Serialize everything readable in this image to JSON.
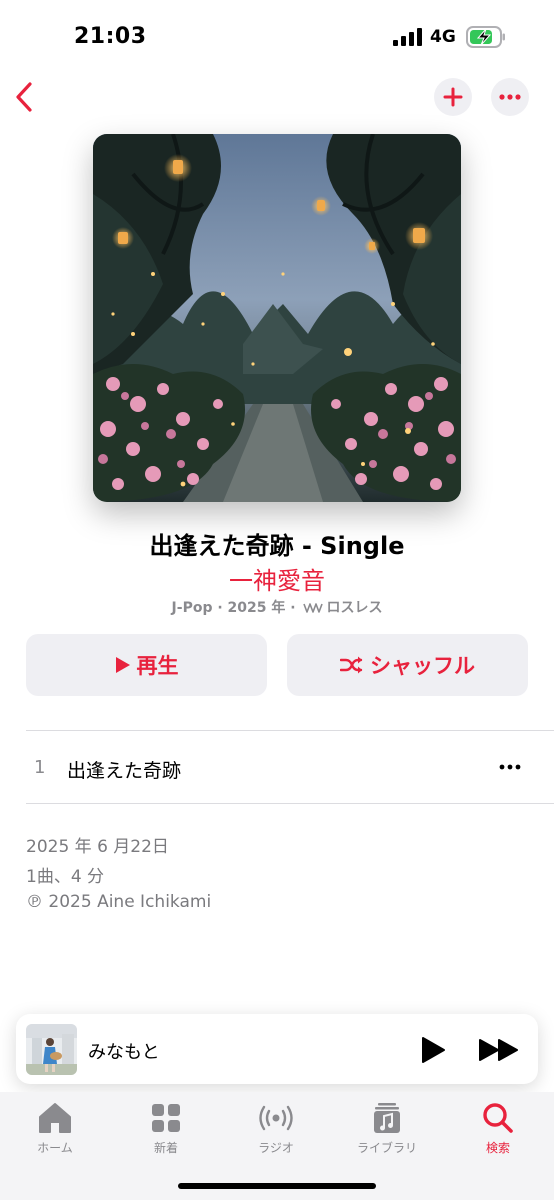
{
  "status_bar": {
    "time": "21:03",
    "network": "4G"
  },
  "album": {
    "title": "出逢えた奇跡 - Single",
    "artist": "一神愛音",
    "meta_genre_year": "J-Pop · 2025 年 ·",
    "meta_quality": "ロスレス"
  },
  "actions": {
    "play_label": "再生",
    "shuffle_label": "シャッフル"
  },
  "tracks": [
    {
      "number": "1",
      "title": "出逢えた奇跡"
    }
  ],
  "info": {
    "release_date": "2025 年 6 月22日",
    "summary": "1曲、4 分",
    "copyright": "℗ 2025 Aine Ichikami"
  },
  "mini_player": {
    "title": "みなもと"
  },
  "tabbar": {
    "items": [
      {
        "label": "ホーム",
        "icon": "home-icon"
      },
      {
        "label": "新着",
        "icon": "grid-icon"
      },
      {
        "label": "ラジオ",
        "icon": "radio-icon"
      },
      {
        "label": "ライブラリ",
        "icon": "library-icon"
      },
      {
        "label": "検索",
        "icon": "search-icon"
      }
    ],
    "active": "検索"
  },
  "colors": {
    "accent": "#e8223d",
    "button_bg": "#efeff3",
    "secondary_text": "#8a8a8e",
    "battery_green": "#34c759"
  }
}
